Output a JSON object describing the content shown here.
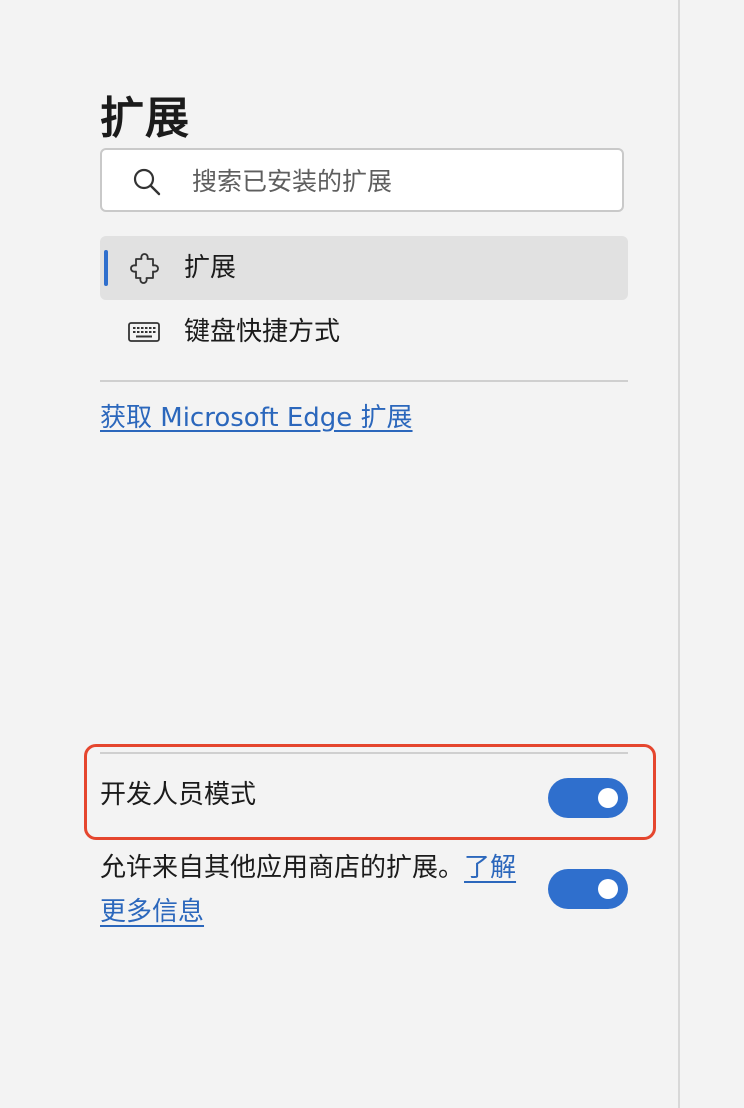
{
  "page": {
    "title": "扩展"
  },
  "search": {
    "placeholder": "搜索已安装的扩展",
    "icon": "search-icon"
  },
  "nav": {
    "items": [
      {
        "label": "扩展",
        "icon": "puzzle-piece-icon",
        "active": true
      },
      {
        "label": "键盘快捷方式",
        "icon": "keyboard-icon",
        "active": false
      }
    ]
  },
  "store": {
    "link_label": "获取 Microsoft Edge 扩展"
  },
  "developer_mode": {
    "label": "开发人员模式",
    "enabled": true
  },
  "other_stores": {
    "label": "允许来自其他应用商店的扩展。",
    "link_label": "了解更多信息",
    "enabled": true
  },
  "colors": {
    "accent": "#2f6fcd",
    "highlight_box": "#e5462e",
    "background": "#f3f3f3",
    "selected_background": "#e1e1e1"
  }
}
